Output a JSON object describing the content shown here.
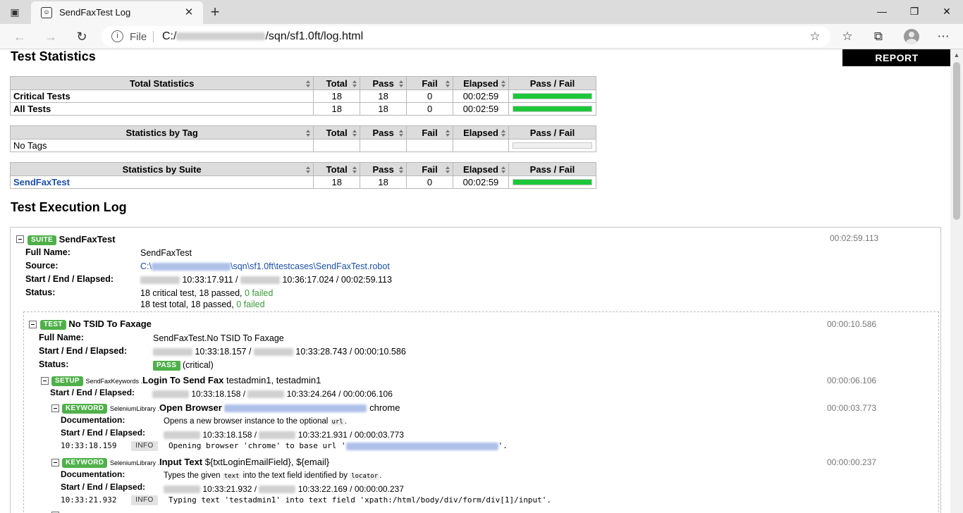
{
  "browser": {
    "tab_title": "SendFaxTest Log",
    "address_scheme": "File",
    "address_prefix": "C:/",
    "address_suffix": "/sqn/sf1.0ft/log.html"
  },
  "page": {
    "stats_heading": "Test Statistics",
    "report_button": "REPORT",
    "log_heading": "Test Execution Log"
  },
  "colors": {
    "pass_bar": "#1cc83a",
    "empty_bar": "#f0f0f0",
    "label_green": "#4fb04a",
    "link_blue": "#1a4fa6"
  },
  "total_stats": {
    "headers": [
      "Total Statistics",
      "Total",
      "Pass",
      "Fail",
      "Elapsed",
      "Pass / Fail"
    ],
    "rows": [
      {
        "name": "Critical Tests",
        "total": "18",
        "pass": "18",
        "fail": "0",
        "elapsed": "00:02:59",
        "pass_ratio": 1.0
      },
      {
        "name": "All Tests",
        "total": "18",
        "pass": "18",
        "fail": "0",
        "elapsed": "00:02:59",
        "pass_ratio": 1.0
      }
    ]
  },
  "tag_stats": {
    "headers": [
      "Statistics by Tag",
      "Total",
      "Pass",
      "Fail",
      "Elapsed",
      "Pass / Fail"
    ],
    "rows": [
      {
        "name": "No Tags",
        "total": "",
        "pass": "",
        "fail": "",
        "elapsed": "",
        "pass_ratio": 0
      }
    ]
  },
  "suite_stats": {
    "headers": [
      "Statistics by Suite",
      "Total",
      "Pass",
      "Fail",
      "Elapsed",
      "Pass / Fail"
    ],
    "rows": [
      {
        "name": "SendFaxTest",
        "total": "18",
        "pass": "18",
        "fail": "0",
        "elapsed": "00:02:59",
        "pass_ratio": 1.0
      }
    ]
  },
  "suite": {
    "label": "SUITE",
    "name": "SendFaxTest",
    "elapsed": "00:02:59.113",
    "full_name_key": "Full Name:",
    "full_name": "SendFaxTest",
    "source_key": "Source:",
    "source_prefix": "C:\\",
    "source_suffix": "\\sqn\\sf1.0ft\\testcases\\SendFaxTest.robot",
    "times_key": "Start / End / Elapsed:",
    "start_time": "10:33:17.911 /",
    "end_time": "10:36:17.024 / 00:02:59.113",
    "status_key": "Status:",
    "status_line1": "18 critical test, 18 passed,",
    "status_line2": "18 test total, 18 passed,",
    "failed_text": "0 failed"
  },
  "test": {
    "label": "TEST",
    "name": "No TSID To Faxage",
    "elapsed": "00:00:10.586",
    "full_name_key": "Full Name:",
    "full_name": "SendFaxTest.No TSID To Faxage",
    "times_key": "Start / End / Elapsed:",
    "start_time": "10:33:18.157 /",
    "end_time": "10:33:28.743 / 00:00:10.586",
    "status_key": "Status:",
    "status_badge": "PASS",
    "status_note": "(critical)"
  },
  "setup": {
    "label": "SETUP",
    "lib": "SendFaxKeywords .",
    "name": "Login To Send Fax",
    "args": "testadmin1, testadmin1",
    "elapsed": "00:00:06.106",
    "times_key": "Start / End / Elapsed:",
    "start_time": "10:33:18.158 /",
    "end_time": "10:33:24.264 / 00:00:06.106"
  },
  "keywords": [
    {
      "label": "KEYWORD",
      "lib": "SeleniumLibrary .",
      "name": "Open Browser",
      "args_after": "chrome",
      "elapsed": "00:00:03.773",
      "doc_key": "Documentation:",
      "doc_pre": "Opens a new browser instance to the optional",
      "doc_code": "url",
      "doc_post": ".",
      "times_key": "Start / End / Elapsed:",
      "start_time": "10:33:18.158 /",
      "end_time": "10:33:21.931 / 00:00:03.773",
      "msg_time": "10:33:18.159",
      "msg_level": "INFO",
      "msg_pre": "Opening browser 'chrome' to base url '",
      "msg_post": "'."
    },
    {
      "label": "KEYWORD",
      "lib": "SeleniumLibrary .",
      "name": "Input Text",
      "args": "${txtLoginEmailField}, ${email}",
      "elapsed": "00:00:00.237",
      "doc_key": "Documentation:",
      "doc_pre": "Types the given",
      "doc_code": "text",
      "doc_mid": "into the text field identified by",
      "doc_code2": "locator",
      "doc_post": ".",
      "times_key": "Start / End / Elapsed:",
      "start_time": "10:33:21.932 /",
      "end_time": "10:33:22.169 / 00:00:00.237",
      "msg_time": "10:33:21.932",
      "msg_level": "INFO",
      "msg_text": "Typing text 'testadmin1' into text field 'xpath:/html/body/div/form/div[1]/input'."
    }
  ]
}
